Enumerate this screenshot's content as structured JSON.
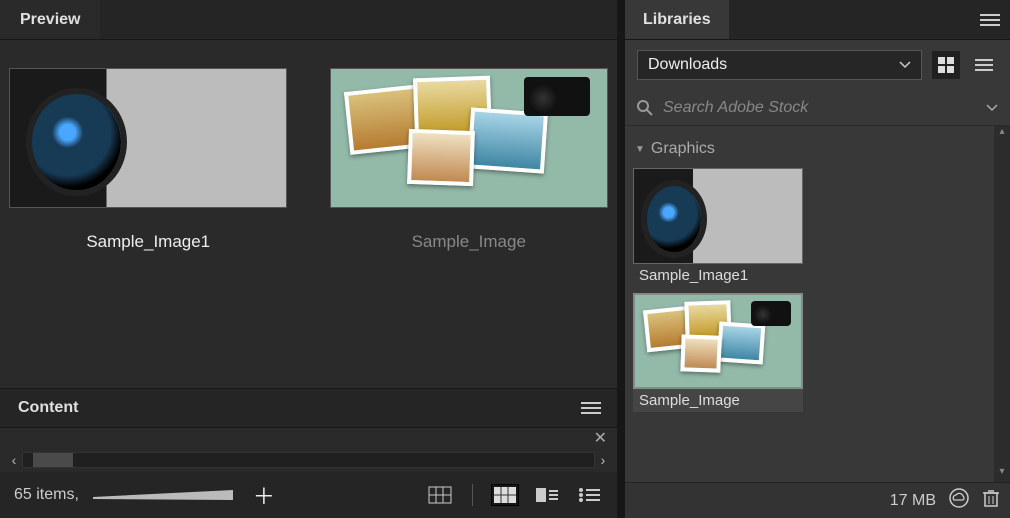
{
  "preview": {
    "tab_label": "Preview",
    "items": [
      {
        "caption": "Sample_Image1",
        "selected": true,
        "art": "camera"
      },
      {
        "caption": "Sample_Image",
        "selected": false,
        "art": "collage"
      }
    ]
  },
  "content": {
    "tab_label": "Content",
    "count_text": "65 items,"
  },
  "libraries": {
    "tab_label": "Libraries",
    "dropdown_value": "Downloads",
    "search_placeholder": "Search Adobe Stock",
    "section_label": "Graphics",
    "items": [
      {
        "caption": "Sample_Image1",
        "art": "camera",
        "selected": false
      },
      {
        "caption": "Sample_Image",
        "art": "collage",
        "selected": true
      }
    ],
    "storage_text": "17 MB"
  }
}
